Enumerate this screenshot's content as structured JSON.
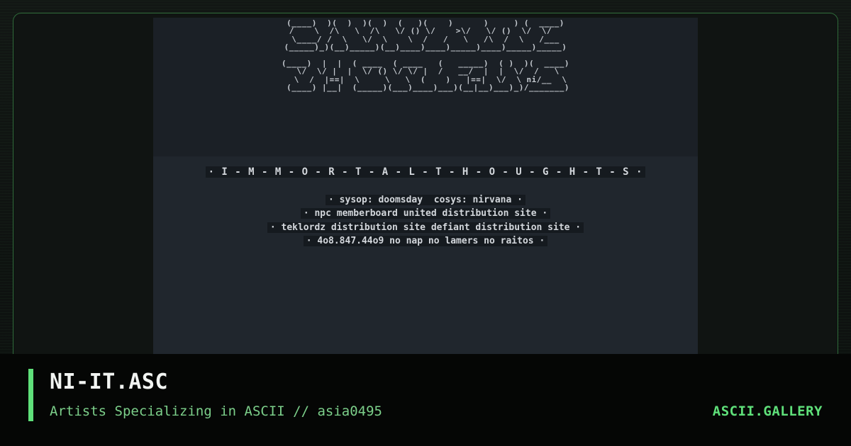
{
  "artwork": {
    "logo_ascii": [
      " (____)  )(  )  )(  )  (   )(    )      )     ) (  ____) ",
      "/    \\  /\\   \\  /\\   \\/ () \\/    >\\/   \\/ ()  \\/  \\/  ",
      "\\____/ /  \\   \\/  \\    \\  /   /   \\   /\\  /  \\   /___",
      "(_____)_)(__)_____)(__)____)____)_____)____)_____)_____)",
      "",
      "(____)  |  |  ( ____  ( ____   (   _____)  ( )  )(  ____)",
      " \\/  \\/ |  |  \\/ () \\/ \\/ |  /   __/  |  |  \\/  /   \\",
      "  \\  /  |==|  \\     \\   \\  (    )   |==|  \\/  \\ ni/__  \\",
      " (____) |__|  (_____)(___)____)___)(__|__)___)_)/_______)"
    ],
    "title_spaced": "· I - M - M - O - R - T - A - L - T - H - O - U - G - H - T - S ·",
    "info_lines": [
      "· sysop: doomsday  cosys: nirvana ·",
      "· npc memberboard united distribution site ·",
      "· teklordz distribution site defiant distribution site ·",
      "· 4o8.847.44o9 no nap no lamers no raitos ·"
    ]
  },
  "footer": {
    "title": "NI-IT.ASC",
    "subtitle": "Artists Specializing in ASCII // asia0495",
    "brand": "ASCII.GALLERY"
  },
  "colors": {
    "accent": "#5fe07a",
    "subtitle": "#7ccf8a",
    "art_background": "#20262d",
    "card_border": "#2f6b3a"
  }
}
